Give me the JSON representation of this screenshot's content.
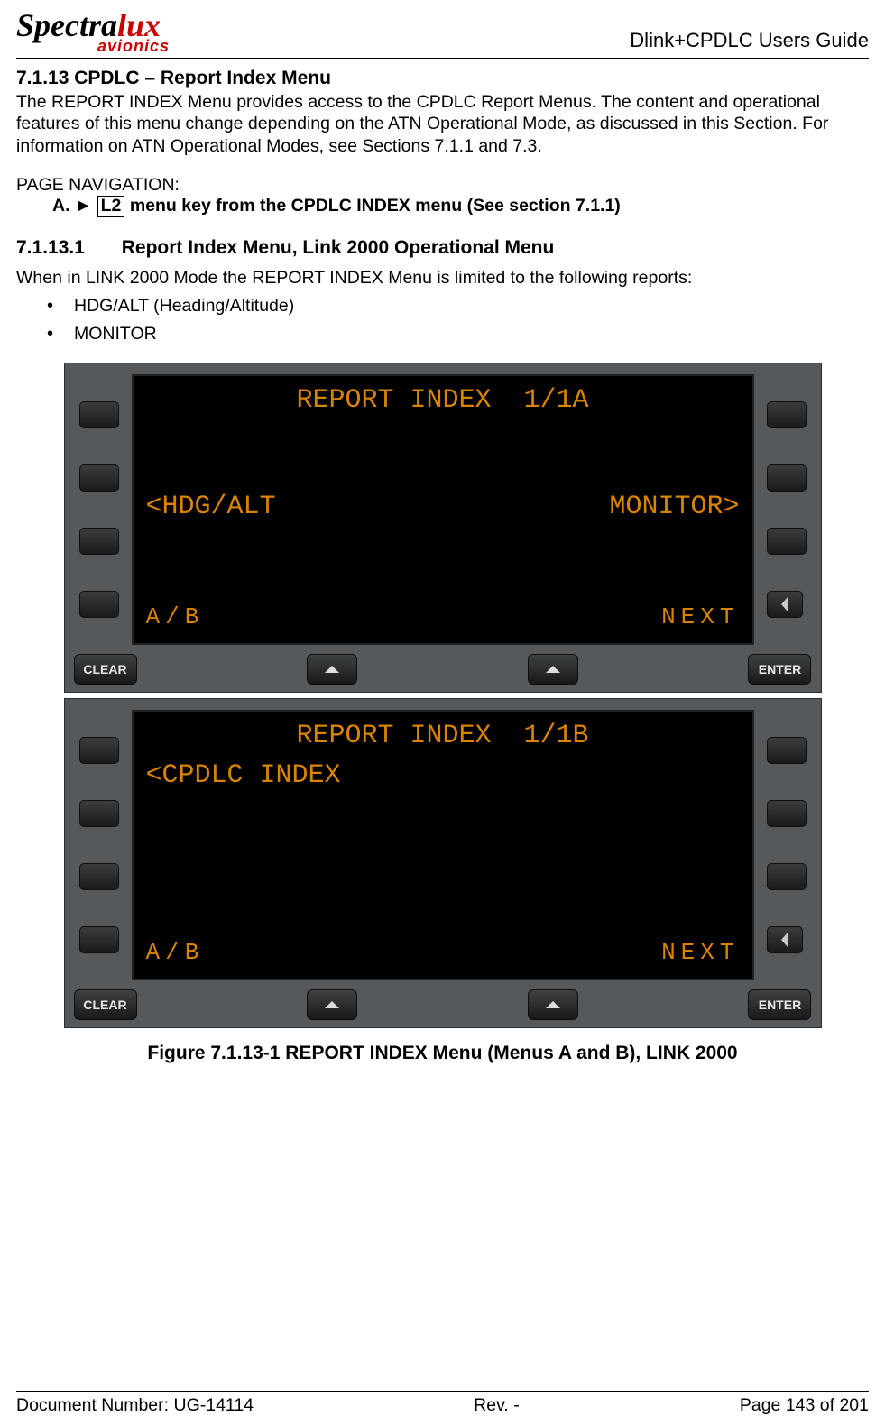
{
  "header": {
    "logo_main": "Spectralux",
    "logo_sub": "avionics",
    "doc_title": "Dlink+CPDLC Users Guide"
  },
  "section": {
    "number_title": "7.1.13 CPDLC – Report Index Menu",
    "para": "The REPORT INDEX Menu provides access to the CPDLC Report Menus. The content and operational features of this menu change depending on the ATN Operational Mode, as discussed in this Section. For information on ATN Operational Modes, see Sections 7.1.1 and 7.3."
  },
  "page_nav": {
    "label": "PAGE NAVIGATION:",
    "item_prefix": "A.   ►",
    "box": "L2",
    "item_suffix": " menu key from the CPDLC INDEX menu (See section 7.1.1)"
  },
  "subsection": {
    "number": "7.1.13.1",
    "title": "Report Index Menu, Link 2000 Operational Menu",
    "intro": "When in LINK 2000 Mode the REPORT INDEX Menu is limited to the following reports:",
    "bullets": [
      "HDG/ALT (Heading/Altitude)",
      "MONITOR"
    ]
  },
  "device_a": {
    "title": "REPORT INDEX  1/1A",
    "left2": "<HDG/ALT",
    "right2": "MONITOR>",
    "left4": "A/B",
    "right4": "NEXT"
  },
  "device_b": {
    "title": "REPORT INDEX  1/1B",
    "left1": "<CPDLC INDEX",
    "left4": "A/B",
    "right4": "NEXT"
  },
  "hardkeys": {
    "clear": "CLEAR",
    "enter": "ENTER"
  },
  "figure_caption": "Figure 7.1.13-1 REPORT INDEX Menu (Menus A and B), LINK 2000",
  "footer": {
    "left": "Document Number:  UG-14114",
    "center": "Rev. -",
    "right": "Page 143 of 201"
  }
}
